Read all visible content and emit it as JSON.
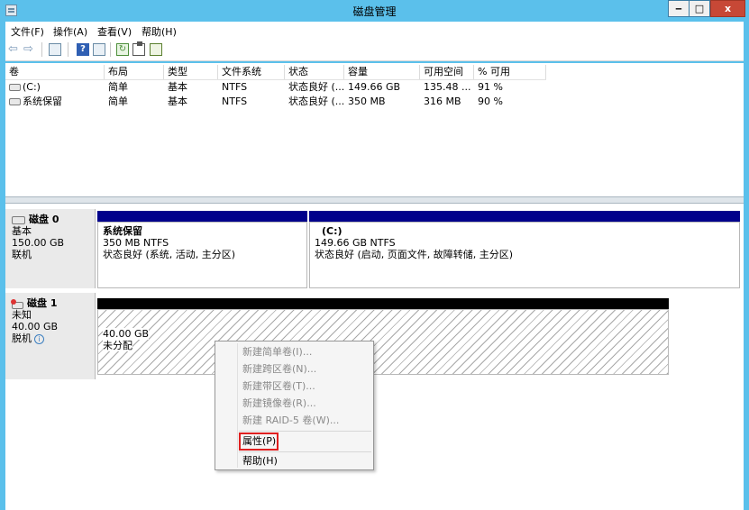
{
  "window": {
    "title": "磁盘管理",
    "min_label": "‒",
    "max_label": "□",
    "close_label": "x"
  },
  "menu": [
    "文件(F)",
    "操作(A)",
    "查看(V)",
    "帮助(H)"
  ],
  "toolbar": {
    "back": "⇦",
    "forward": "⇨",
    "help": "?",
    "refresh": "↻"
  },
  "volume_table": {
    "headers": [
      "卷",
      "布局",
      "类型",
      "文件系统",
      "状态",
      "容量",
      "可用空间",
      "% 可用"
    ],
    "rows": [
      {
        "name": "(C:)",
        "layout": "简单",
        "type": "基本",
        "fs": "NTFS",
        "status": "状态良好 (...",
        "capacity": "149.66 GB",
        "free": "135.48 ...",
        "pct": "91 %"
      },
      {
        "name": "系统保留",
        "layout": "简单",
        "type": "基本",
        "fs": "NTFS",
        "status": "状态良好 (...",
        "capacity": "350 MB",
        "free": "316 MB",
        "pct": "90 %"
      }
    ]
  },
  "disks": [
    {
      "name": "磁盘 0",
      "kind": "基本",
      "size": "150.00 GB",
      "state": "联机",
      "partitions": [
        {
          "title": "系统保留",
          "size_fs": "350 MB NTFS",
          "status": "状态良好 (系统, 活动, 主分区)"
        },
        {
          "title": "(C:)",
          "size_fs": "149.66 GB NTFS",
          "status": "状态良好 (启动, 页面文件, 故障转储, 主分区)"
        }
      ]
    },
    {
      "name": "磁盘 1",
      "kind": "未知",
      "size": "40.00 GB",
      "state": "脱机",
      "partitions": [
        {
          "size": "40.00 GB",
          "status": "未分配"
        }
      ]
    }
  ],
  "context_menu": {
    "items": [
      "新建简单卷(I)...",
      "新建跨区卷(N)...",
      "新建带区卷(T)...",
      "新建镜像卷(R)...",
      "新建 RAID-5 卷(W)...",
      "属性(P)",
      "帮助(H)"
    ]
  },
  "colors": {
    "accent": "#5bc0eb",
    "primary_partition": "#00008b",
    "unallocated": "#000000",
    "highlight": "#e02020"
  }
}
